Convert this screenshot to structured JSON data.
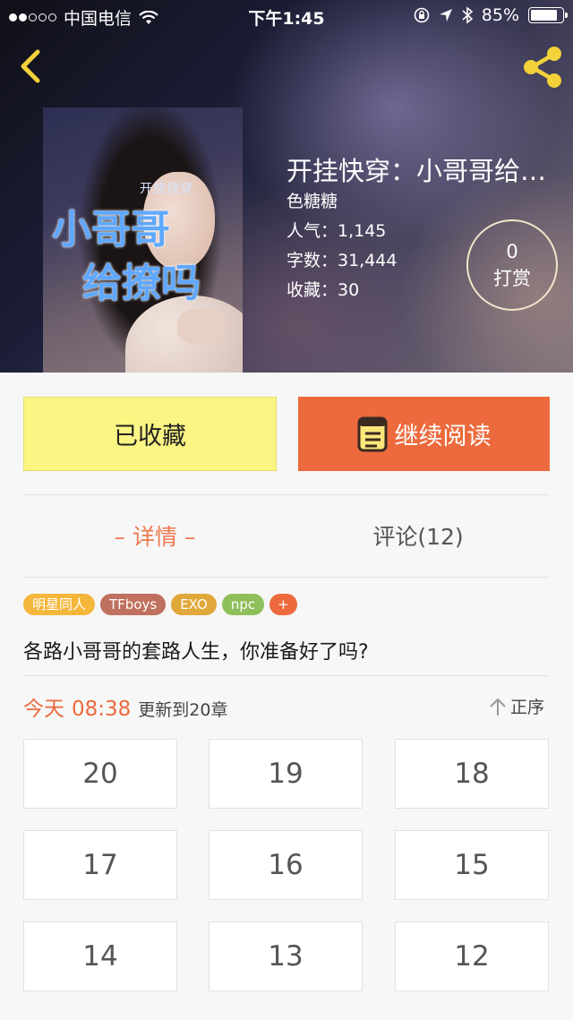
{
  "status_bar": {
    "carrier": "中国电信",
    "time": "下午1:45",
    "battery_text": "85%",
    "battery_level": 0.85
  },
  "book": {
    "title": "开挂快穿：小哥哥给撩吗",
    "author": "色糖糖",
    "popularity": "人气：1,145",
    "word_count": "字数：31,444",
    "favorites": "收藏：30",
    "cover_text_small": "开挂快穿",
    "cover_text_line1": "小哥哥",
    "cover_text_line2": "给撩吗"
  },
  "tip": {
    "count": "0",
    "label": "打赏"
  },
  "actions": {
    "collected_label": "已收藏",
    "read_label": "继续阅读"
  },
  "tabs": {
    "detail": "– 详情 –",
    "comments": "评论(12)"
  },
  "tags": [
    "明星同人",
    "TFboys",
    "EXO",
    "npc",
    "+"
  ],
  "summary": "各路小哥哥的套路人生，你准备好了吗?",
  "update": {
    "today": "今天",
    "time": "08:38",
    "chapter": "更新到20章"
  },
  "sort_label": "正序",
  "chapters": [
    "20",
    "19",
    "18",
    "17",
    "16",
    "15",
    "14",
    "13",
    "12"
  ],
  "colors": {
    "accent": "#ec6a3d",
    "collected_bg": "#fbf584",
    "share_icon": "#f2d13a"
  }
}
